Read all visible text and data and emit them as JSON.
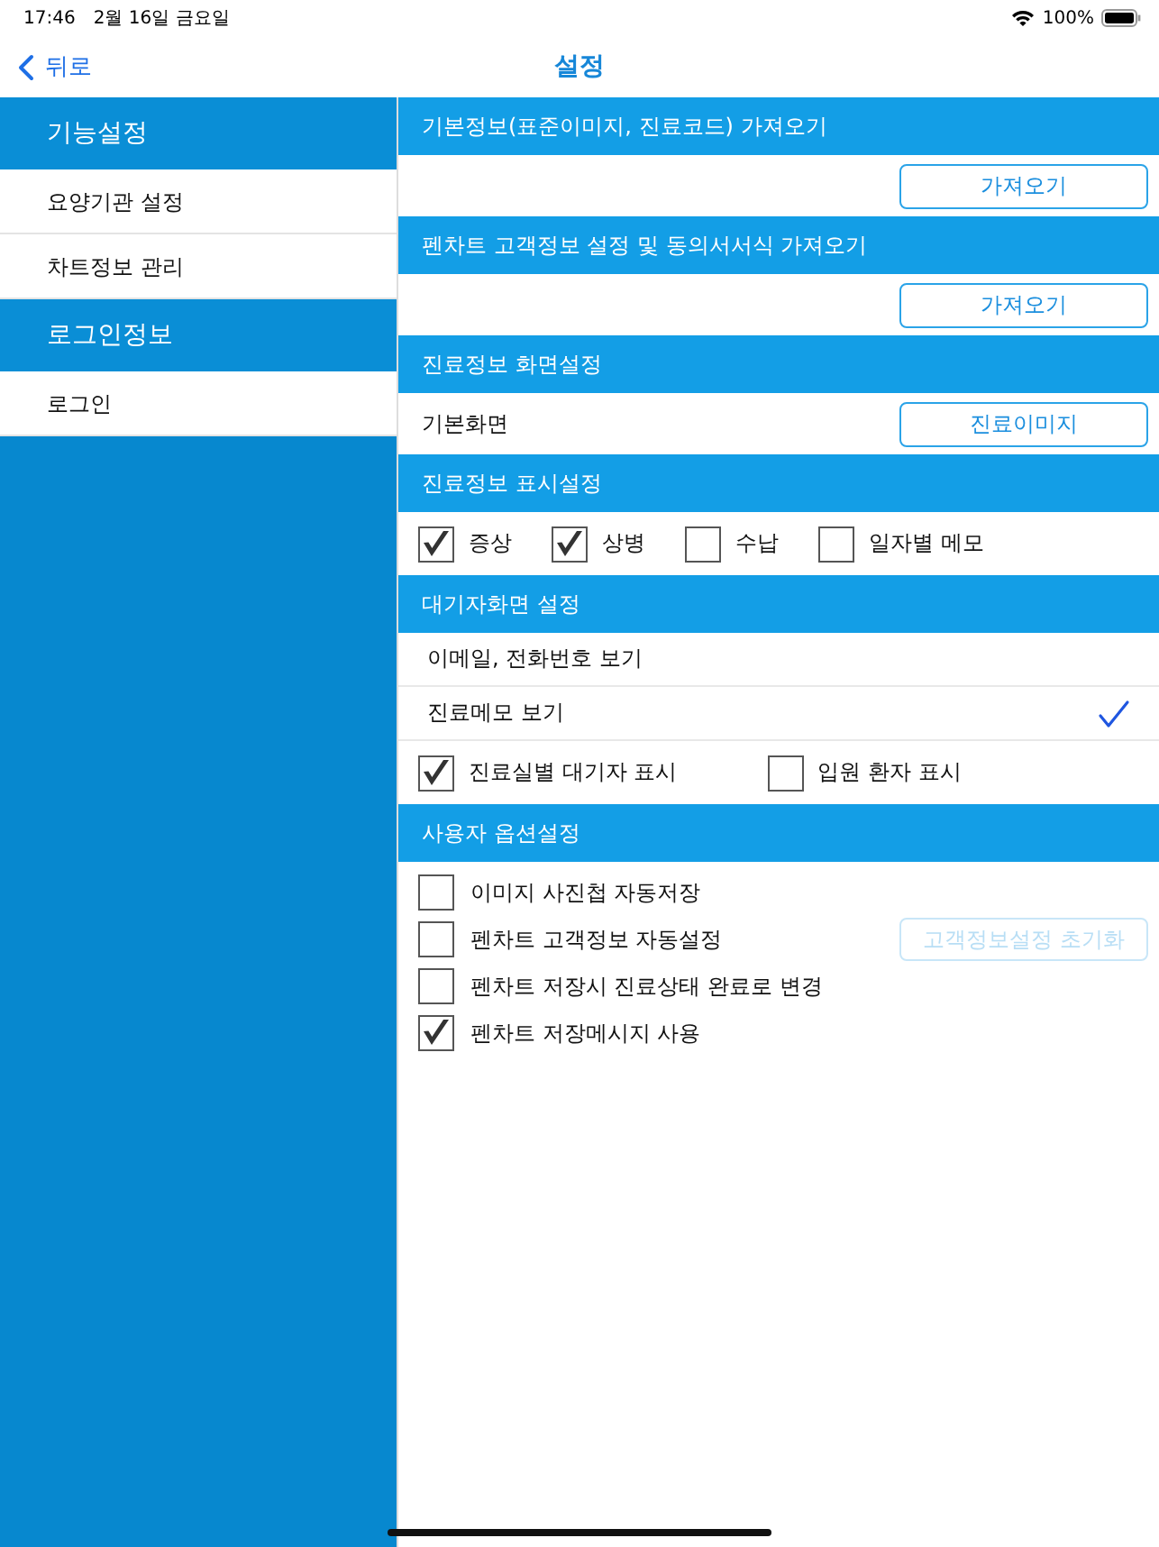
{
  "status_bar": {
    "time": "17:46",
    "date": "2월 16일 금요일",
    "battery": "100%"
  },
  "nav": {
    "back": "뒤로",
    "title": "설정"
  },
  "sidebar": {
    "groups": [
      {
        "title": "기능설정",
        "items": [
          {
            "label": "요양기관 설정"
          },
          {
            "label": "차트정보 관리"
          }
        ]
      },
      {
        "title": "로그인정보",
        "items": [
          {
            "label": "로그인"
          }
        ]
      }
    ]
  },
  "sections": [
    {
      "title": "기본정보(표준이미지, 진료코드) 가져오기",
      "rows": [
        {
          "kind": "button",
          "button": {
            "label": "가져오기",
            "disabled": false
          }
        }
      ]
    },
    {
      "title": "펜차트 고객정보 설정 및 동의서서식 가져오기",
      "rows": [
        {
          "kind": "button",
          "button": {
            "label": "가져오기",
            "disabled": false
          }
        }
      ]
    },
    {
      "title": "진료정보 화면설정",
      "rows": [
        {
          "kind": "button",
          "label": "기본화면",
          "button": {
            "label": "진료이미지",
            "disabled": false
          }
        }
      ]
    },
    {
      "title": "진료정보 표시설정",
      "rows": [
        {
          "kind": "checks",
          "items": [
            {
              "label": "증상",
              "checked": true
            },
            {
              "label": "상병",
              "checked": true
            },
            {
              "label": "수납",
              "checked": false
            },
            {
              "label": "일자별 메모",
              "checked": false
            }
          ]
        }
      ]
    },
    {
      "title": "대기자화면 설정",
      "rows": [
        {
          "kind": "option",
          "label": "이메일, 전화번호 보기",
          "checked": false
        },
        {
          "kind": "option",
          "label": "진료메모 보기",
          "checked": true
        },
        {
          "kind": "checks",
          "items": [
            {
              "label": "진료실별 대기자 표시",
              "checked": true
            },
            {
              "label": "입원 환자 표시",
              "checked": false
            }
          ]
        }
      ]
    },
    {
      "title": "사용자 옵션설정",
      "rows": [
        {
          "kind": "check",
          "label": "이미지 사진첩 자동저장",
          "checked": false
        },
        {
          "kind": "check",
          "label": "펜차트 고객정보 자동설정",
          "checked": false,
          "button": {
            "label": "고객정보설정 초기화",
            "disabled": true
          }
        },
        {
          "kind": "check",
          "label": "펜차트 저장시 진료상태 완료로 변경",
          "checked": false
        },
        {
          "kind": "check",
          "label": "펜차트 저장메시지 사용",
          "checked": true
        }
      ]
    }
  ]
}
